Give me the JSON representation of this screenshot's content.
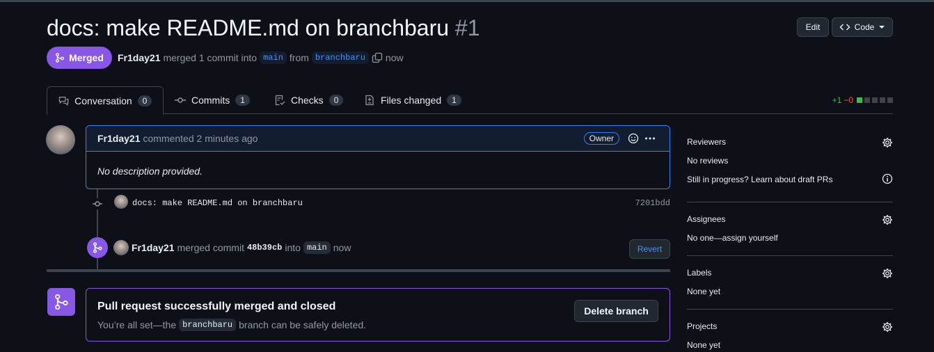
{
  "header": {
    "title": "docs: make README.md on branchbaru",
    "number": "#1",
    "edit_label": "Edit",
    "code_label": "Code"
  },
  "status": {
    "state_label": "Merged",
    "author": "Fr1day21",
    "merged_text": "merged 1 commit into",
    "base_branch": "main",
    "from_text": "from",
    "head_branch": "branchbaru",
    "time": "now"
  },
  "tabs": [
    {
      "label": "Conversation",
      "count": "0"
    },
    {
      "label": "Commits",
      "count": "1"
    },
    {
      "label": "Checks",
      "count": "0"
    },
    {
      "label": "Files changed",
      "count": "1"
    }
  ],
  "diffstat": {
    "additions": "+1",
    "deletions": "−0"
  },
  "comment": {
    "author": "Fr1day21",
    "action": "commented 2 minutes ago",
    "badge": "Owner",
    "body": "No description provided."
  },
  "commit": {
    "message": "docs: make README.md on branchbaru",
    "sha": "7201bdd"
  },
  "merge_event": {
    "author": "Fr1day21",
    "text": "merged commit",
    "sha": "48b39cb",
    "into_text": "into",
    "branch": "main",
    "time": "now",
    "revert_label": "Revert"
  },
  "merged_box": {
    "title": "Pull request successfully merged and closed",
    "text_before": "You’re all set—the",
    "branch": "branchbaru",
    "text_after": "branch can be safely deleted.",
    "delete_label": "Delete branch"
  },
  "sidebar": {
    "reviewers": {
      "title": "Reviewers",
      "value": "No reviews",
      "draft_hint": "Still in progress? Learn about draft PRs"
    },
    "assignees": {
      "title": "Assignees",
      "value": "No one—assign yourself"
    },
    "labels": {
      "title": "Labels",
      "value": "None yet"
    },
    "projects": {
      "title": "Projects",
      "value": "None yet"
    }
  },
  "colors": {
    "merged": "#8957e5",
    "accent": "#2f81f7",
    "add": "#3fb950",
    "del": "#f85149"
  }
}
